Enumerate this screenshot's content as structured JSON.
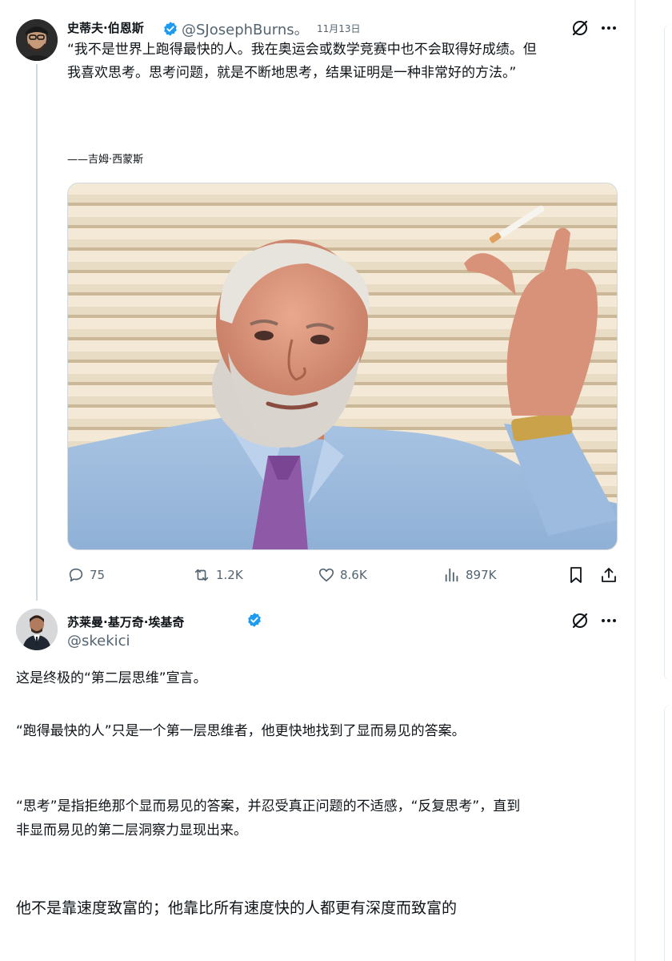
{
  "tweet1": {
    "author_name": "史蒂夫·伯恩斯",
    "handle": "@SJosephBurns。",
    "date": "11月13日",
    "text_line1": "“我不是世界上跑得最快的人。我在奥运会或数学竞赛中也不会取得好成绩。但",
    "text_line2": "我喜欢思考。思考问题，就是不断地思考，结果证明是一种非常好的方法。”",
    "attribution": "——吉姆·西蒙斯",
    "stats": {
      "replies": "75",
      "reposts": "1.2K",
      "likes": "8.6K",
      "views": "897K"
    }
  },
  "tweet2": {
    "author_name": "苏莱曼·基万奇·埃基奇",
    "handle": "@skekici",
    "paragraph1": "这是终极的“第二层思维”宣言。",
    "paragraph2": "“跑得最快的人”只是一个第一层思维者，他更快地找到了显而易见的答案。",
    "paragraph3_line1": "“思考”是指拒绝那个显而易见的答案，并忍受真正问题的不适感，“反复思考”，直到",
    "paragraph3_line2": "非显而易见的第二层洞察力显现出来。",
    "paragraph4": "他不是靠速度致富的；他靠比所有速度快的人都更有深度而致富的"
  },
  "colors": {
    "text": "#0f1419",
    "secondary": "#536471",
    "verified": "#1d9bf0",
    "border": "#cfd9de"
  },
  "icons": [
    "verified-badge-icon",
    "grok-icon",
    "more-icon",
    "reply-icon",
    "repost-icon",
    "like-icon",
    "views-icon",
    "bookmark-icon",
    "share-icon"
  ]
}
